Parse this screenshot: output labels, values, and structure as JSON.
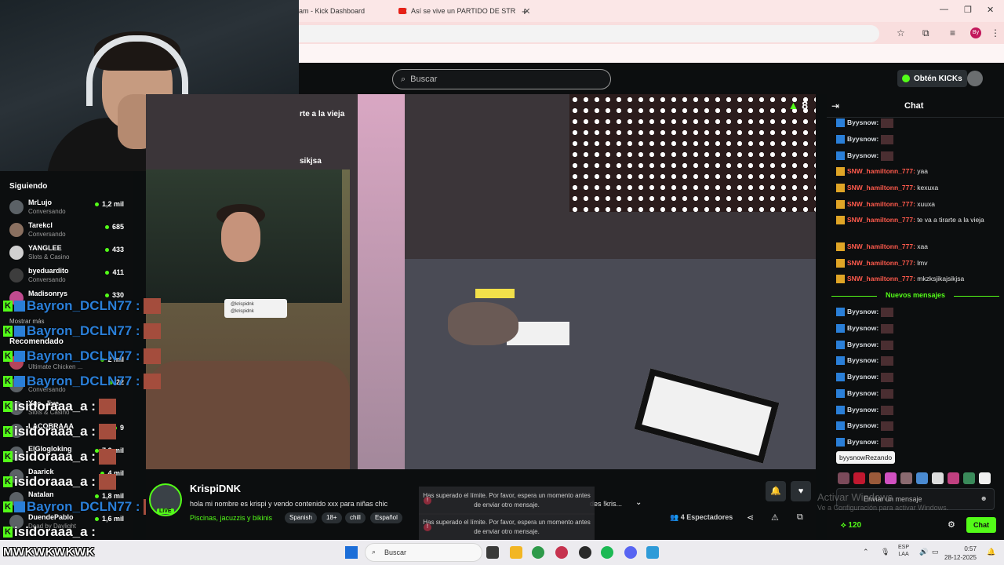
{
  "browser": {
    "tabs": [
      {
        "label": "am - Kick Dashboard"
      },
      {
        "label": "Así se vive un PARTIDO DE STR"
      }
    ],
    "new_tab": "+",
    "win_min": "—",
    "win_max": "❐",
    "win_close": "✕"
  },
  "header": {
    "search_placeholder": "Buscar",
    "kicks_button": "Obtén KICKs"
  },
  "sidebar": {
    "following_heading": "Siguiendo",
    "following": [
      {
        "name": "MrLujo",
        "sub": "Conversando",
        "count": "1,2 mil"
      },
      {
        "name": "Tarekcl",
        "sub": "Conversando",
        "count": "685"
      },
      {
        "name": "YANGLEE",
        "sub": "Slots & Casino",
        "count": "433"
      },
      {
        "name": "byeduardito",
        "sub": "Conversando",
        "count": "411"
      },
      {
        "name": "Madisonrys",
        "sub": "",
        "count": "330"
      }
    ],
    "show_more": "Mostrar más",
    "recommended_heading": "Recomendado",
    "recommended": [
      {
        "name": "",
        "sub": "Ultimate Chicken ...",
        "count": "2 mil"
      },
      {
        "name": "",
        "sub": "Conversando",
        "count": "22"
      },
      {
        "name": "Xqc...live",
        "sub": "Slots & Casino",
        "count": ""
      },
      {
        "name": "LACOBRAAA",
        "sub": "",
        "count": "9"
      },
      {
        "name": "ElGlogloking",
        "sub": "",
        "count": "7,2 mil"
      },
      {
        "name": "Daarick",
        "sub": "",
        "count": "4 mil"
      },
      {
        "name": "Natalan",
        "sub": "",
        "count": "1,8 mil"
      },
      {
        "name": "DuendePablo",
        "sub": "Dead by Daylight",
        "count": "1,6 mil"
      }
    ]
  },
  "video": {
    "overlay_text_1": "rte a la vieja",
    "overlay_text_2": "sikjsa",
    "corner_count": "8",
    "social_handle_1": "@krispidnk",
    "social_handle_2": "@krispidnk"
  },
  "alerts": [
    {
      "name": "Bayron_DCLN77 :",
      "color": "#2a7fd8"
    },
    {
      "name": "Bayron_DCLN77 :",
      "color": "#2a7fd8"
    },
    {
      "name": "Bayron_DCLN77 :",
      "color": "#2a7fd8"
    },
    {
      "name": "Bayron_DCLN77 :",
      "color": "#2a7fd8"
    },
    {
      "name": "isidoraaa_a :",
      "color": "#ffffff"
    },
    {
      "name": "isidoraaa_a :",
      "color": "#ffffff"
    },
    {
      "name": "isidoraaa_a :",
      "color": "#ffffff"
    },
    {
      "name": "isidoraaa_a :",
      "color": "#ffffff"
    },
    {
      "name": "Bayron_DCLN77 :",
      "color": "#2a7fd8"
    },
    {
      "name": "isidoraaa_a :",
      "color": "#ffffff"
    }
  ],
  "stream": {
    "streamer": "KrispiDNK",
    "live_label": "LIVE",
    "title": "hola mi nombre es krispi y vendo contenido xxx para niñas chic",
    "title_tail": "des !kris...",
    "category": "Piscinas, jacuzzis y bikinis",
    "tags": [
      "Spanish",
      "18+",
      "chill",
      "Español"
    ],
    "viewers": "4 Espectadores",
    "toast_message": "Has superado el límite. Por favor, espera un momento antes de enviar otro mensaje."
  },
  "chat": {
    "title": "Chat",
    "messages_top": [
      {
        "user": "Byysnow:",
        "text": "",
        "badge": "blue",
        "emote": true
      },
      {
        "user": "Byysnow:",
        "text": "",
        "badge": "blue",
        "emote": true
      },
      {
        "user": "Byysnow:",
        "text": "",
        "badge": "blue",
        "emote": true
      },
      {
        "user": "SNW_hamiltonn_777:",
        "text": " yaa",
        "badge": "gold",
        "emote": false
      },
      {
        "user": "SNW_hamiltonn_777:",
        "text": " kexuxa",
        "badge": "gold",
        "emote": false
      },
      {
        "user": "SNW_hamiltonn_777:",
        "text": " xuuxa",
        "badge": "gold",
        "emote": false
      },
      {
        "user": "SNW_hamiltonn_777:",
        "text": " te va a tirarte a la vieja",
        "badge": "gold",
        "emote": false
      },
      {
        "user": "SNW_hamiltonn_777:",
        "text": " xaa",
        "badge": "gold",
        "emote": false
      },
      {
        "user": "SNW_hamiltonn_777:",
        "text": " lmv",
        "badge": "gold",
        "emote": false
      },
      {
        "user": "SNW_hamiltonn_777:",
        "text": " mkzksjikajsikjsa",
        "badge": "gold",
        "emote": false
      }
    ],
    "new_messages": "Nuevos mensajes",
    "messages_bottom": [
      {
        "user": "Byysnow:"
      },
      {
        "user": "Byysnow:"
      },
      {
        "user": "Byysnow:"
      },
      {
        "user": "Byysnow:"
      },
      {
        "user": "Byysnow:"
      },
      {
        "user": "Byysnow:"
      },
      {
        "user": "Byysnow:"
      },
      {
        "user": "Byysnow:"
      },
      {
        "user": "Byysnow:"
      }
    ],
    "tooltip": "byysnowRezando",
    "input_placeholder": "Enviar un mensaje",
    "kicks_count": "120",
    "send_label": "Chat",
    "activate_title": "Activar Windows",
    "activate_sub": "Ve a Configuración para activar Windows."
  },
  "taskbar": {
    "overlay_text": "MWKWKWKWK",
    "search_placeholder": "Buscar",
    "lang_1": "ESP",
    "lang_2": "LAA",
    "time": "0:57",
    "date": "28-12-2025"
  }
}
